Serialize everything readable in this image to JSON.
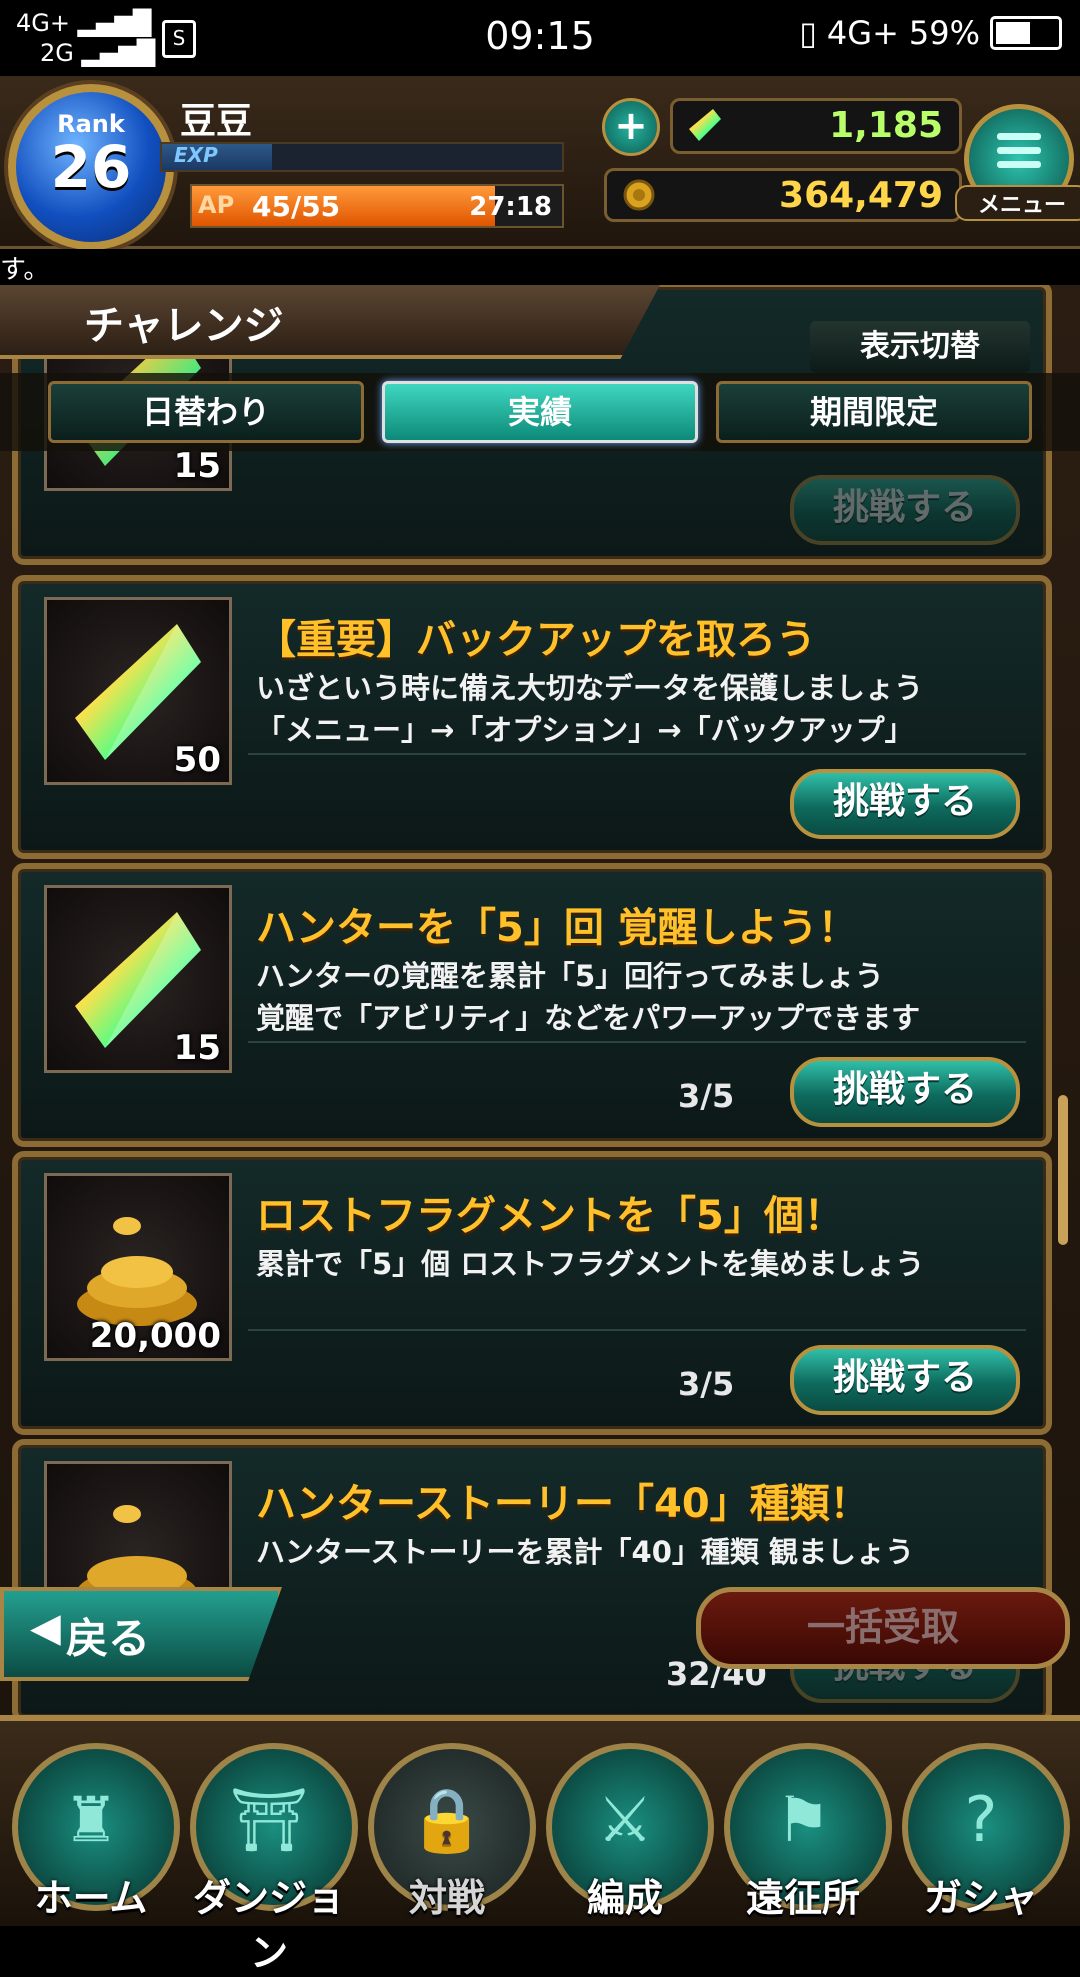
{
  "status": {
    "network_left": "4G+",
    "network_left2": "2G",
    "time": "09:15",
    "network_right": "4G+",
    "battery": "59%"
  },
  "header": {
    "rank_label": "Rank",
    "rank": "26",
    "player_name": "豆豆",
    "exp_label": "EXP",
    "ap_label": "AP",
    "ap_value": "45/55",
    "ap_fraction": 0.818,
    "ap_timer": "27:18",
    "gems": "1,185",
    "gold": "364,479",
    "menu_label": "メニュー",
    "plus_label": "+"
  },
  "ticker": "す。",
  "panel": {
    "title": "チャレンジ",
    "toggle": "表示切替",
    "tabs": [
      "日替わり",
      "実績",
      "期間限定"
    ],
    "active_tab": 1
  },
  "cards": [
    {
      "qty": "15",
      "reward_icon": "rainbow-crystal-icon",
      "title": "",
      "desc": [
        "",
        ""
      ],
      "progress": "",
      "button": "挑戦する",
      "button_enabled": false
    },
    {
      "qty": "50",
      "reward_icon": "rainbow-crystal-icon",
      "title": "【重要】バックアップを取ろう",
      "desc": [
        "いざという時に備え大切なデータを保護しましょう",
        "「メニュー」→「オプション」→「バックアップ」"
      ],
      "progress": "",
      "button": "挑戦する",
      "button_enabled": true
    },
    {
      "qty": "15",
      "reward_icon": "rainbow-crystal-icon",
      "title": "ハンターを「5」回 覚醒しよう！",
      "desc": [
        "ハンターの覚醒を累計「5」回行ってみましょう",
        "覚醒で「アビリティ」などをパワーアップできます"
      ],
      "progress": "3/5",
      "button": "挑戦する",
      "button_enabled": true
    },
    {
      "qty": "20,000",
      "reward_icon": "gold-coins-icon",
      "title": "ロストフラグメントを「5」個！",
      "desc": [
        "累計で「5」個 ロストフラグメントを集めましょう",
        ""
      ],
      "progress": "3/5",
      "button": "挑戦する",
      "button_enabled": true
    },
    {
      "qty": "",
      "reward_icon": "gold-coins-icon",
      "title": "ハンターストーリー「40」種類！",
      "desc": [
        "ハンターストーリーを累計「40」種類 観ましょう",
        ""
      ],
      "progress": "32/40",
      "button": "挑戦する",
      "button_enabled": false
    }
  ],
  "back_button": "戻る",
  "claim_all_button": "一括受取",
  "nav": [
    {
      "label": "ホーム",
      "icon": "home-castle-icon",
      "locked": false
    },
    {
      "label": "ダンジョン",
      "icon": "dungeon-gate-icon",
      "locked": false
    },
    {
      "label": "対戦",
      "icon": "lock-icon",
      "locked": true
    },
    {
      "label": "編成",
      "icon": "party-formation-icon",
      "locked": false
    },
    {
      "label": "遠征所",
      "icon": "expedition-flag-icon",
      "locked": false
    },
    {
      "label": "ガシャ",
      "icon": "gacha-tombstone-icon",
      "locked": false
    }
  ],
  "colors": {
    "accent_teal": "#2fbfa8",
    "title_gold": "#ffc02a",
    "frame_gold": "#b8913f",
    "gem_green": "#b8ff6a",
    "gold_yellow": "#ffd54a"
  }
}
